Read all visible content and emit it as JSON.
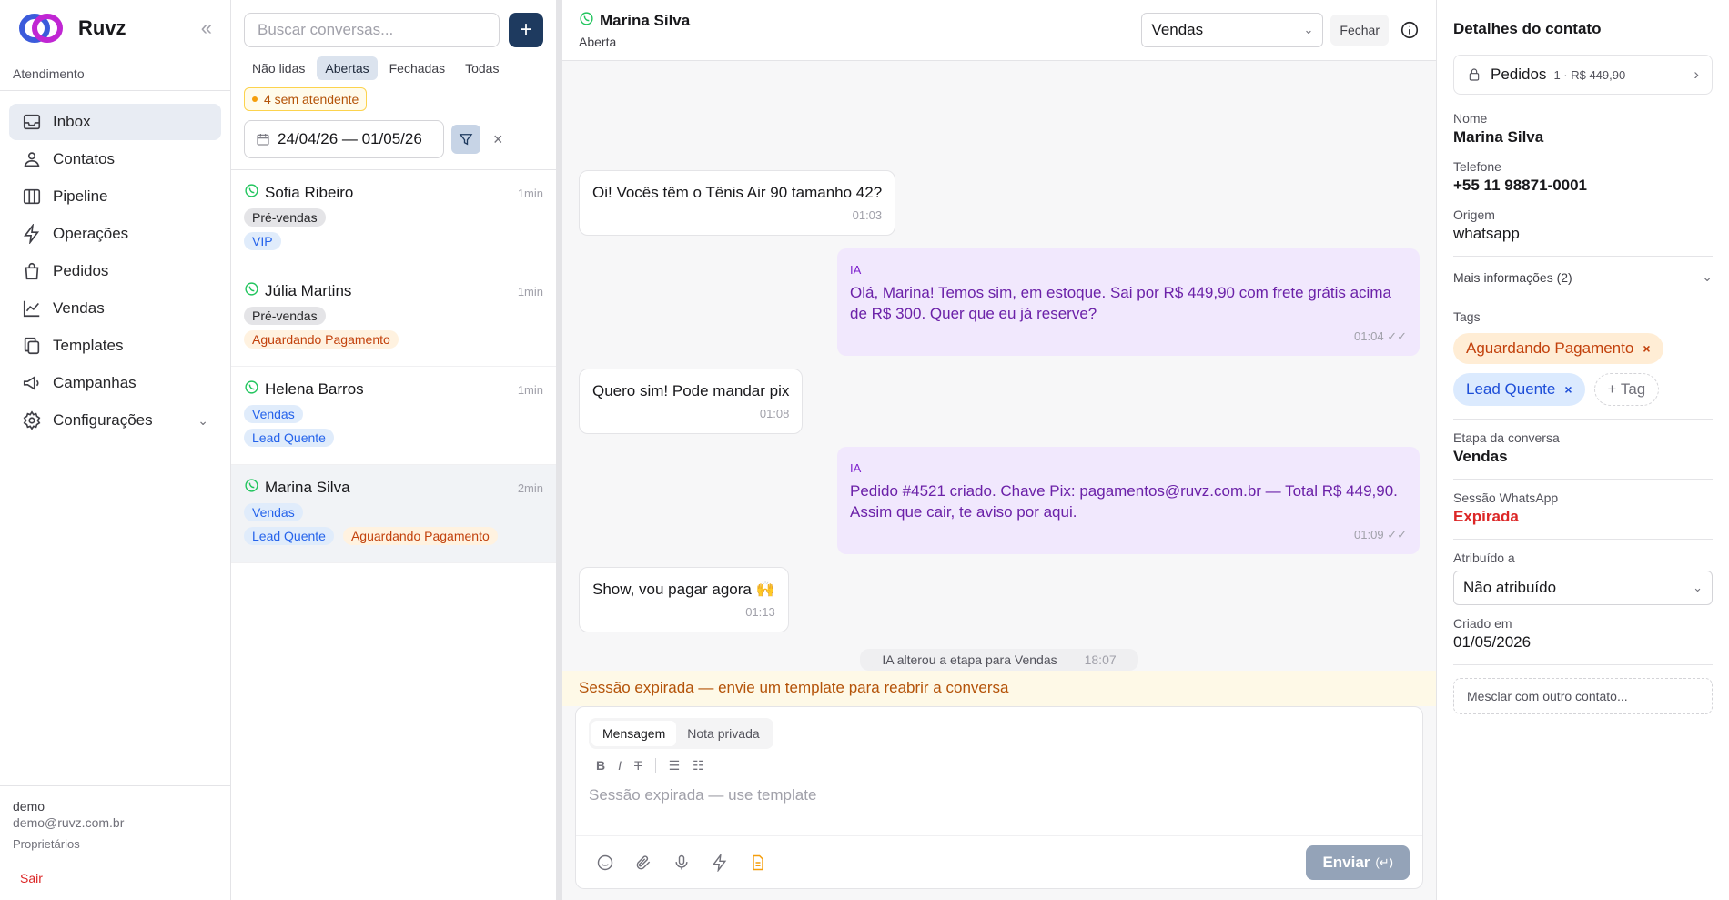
{
  "app": {
    "name": "Ruvz"
  },
  "sidebar": {
    "section": "Atendimento",
    "items": [
      {
        "label": "Inbox"
      },
      {
        "label": "Contatos"
      },
      {
        "label": "Pipeline"
      },
      {
        "label": "Operações"
      },
      {
        "label": "Pedidos"
      },
      {
        "label": "Vendas"
      },
      {
        "label": "Templates"
      },
      {
        "label": "Campanhas"
      },
      {
        "label": "Configurações"
      }
    ],
    "user": {
      "name": "demo",
      "email": "demo@ruvz.com.br",
      "role": "Proprietários",
      "logout": "Sair"
    }
  },
  "convlist": {
    "search_placeholder": "Buscar conversas...",
    "filters": [
      "Não lidas",
      "Abertas",
      "Fechadas",
      "Todas"
    ],
    "unassigned": "4 sem atendente",
    "date_range": "24/04/26 — 01/05/26",
    "conversations": [
      {
        "name": "Sofia Ribeiro",
        "time": "1min",
        "stage": "Pré-vendas",
        "tags": [
          "VIP"
        ]
      },
      {
        "name": "Júlia Martins",
        "time": "1min",
        "stage": "Pré-vendas",
        "tags": [
          "Aguardando Pagamento"
        ]
      },
      {
        "name": "Helena Barros",
        "time": "1min",
        "stage": "Vendas",
        "tags": [
          "Lead Quente"
        ]
      },
      {
        "name": "Marina Silva",
        "time": "2min",
        "stage": "Vendas",
        "tags": [
          "Lead Quente",
          "Aguardando Pagamento"
        ]
      }
    ]
  },
  "chat": {
    "contact": "Marina Silva",
    "status": "Aberta",
    "stage": "Vendas",
    "close_label": "Fechar",
    "messages": [
      {
        "dir": "in",
        "text": "Oi! Vocês têm o Tênis Air 90 tamanho 42?",
        "time": "01:03"
      },
      {
        "dir": "out",
        "who": "IA",
        "text": "Olá, Marina! Temos sim, em estoque. Sai por R$ 449,90 com frete grátis acima de R$ 300. Quer que eu já reserve?",
        "time": "01:04"
      },
      {
        "dir": "in",
        "text": "Quero sim! Pode mandar pix",
        "time": "01:08"
      },
      {
        "dir": "out",
        "who": "IA",
        "text": "Pedido #4521 criado. Chave Pix: pagamentos@ruvz.com.br — Total R$ 449,90. Assim que cair, te aviso por aqui.",
        "time": "01:09"
      },
      {
        "dir": "in",
        "text": "Show, vou pagar agora 🙌",
        "time": "01:13"
      }
    ],
    "system_event": {
      "text": "IA alterou a etapa para Vendas",
      "time": "18:07"
    },
    "expired_banner": "Sessão expirada — envie um template para reabrir a conversa",
    "composer": {
      "tabs": [
        "Mensagem",
        "Nota privada"
      ],
      "placeholder": "Sessão expirada — use template",
      "send_label": "Enviar",
      "send_hint": "(↵)"
    }
  },
  "details": {
    "title": "Detalhes do contato",
    "orders_label": "Pedidos",
    "orders_summary": "1 · R$ 449,90",
    "name_label": "Nome",
    "name": "Marina Silva",
    "phone_label": "Telefone",
    "phone": "+55 11 98871-0001",
    "origin_label": "Origem",
    "origin": "whatsapp",
    "more_info": "Mais informações (2)",
    "tags_label": "Tags",
    "tags": [
      "Aguardando Pagamento",
      "Lead Quente"
    ],
    "add_tag": "+ Tag",
    "stage_label": "Etapa da conversa",
    "stage": "Vendas",
    "session_label": "Sessão WhatsApp",
    "session": "Expirada",
    "assigned_label": "Atribuído a",
    "assigned": "Não atribuído",
    "created_label": "Criado em",
    "created": "01/05/2026",
    "merge": "Mesclar com outro contato..."
  }
}
